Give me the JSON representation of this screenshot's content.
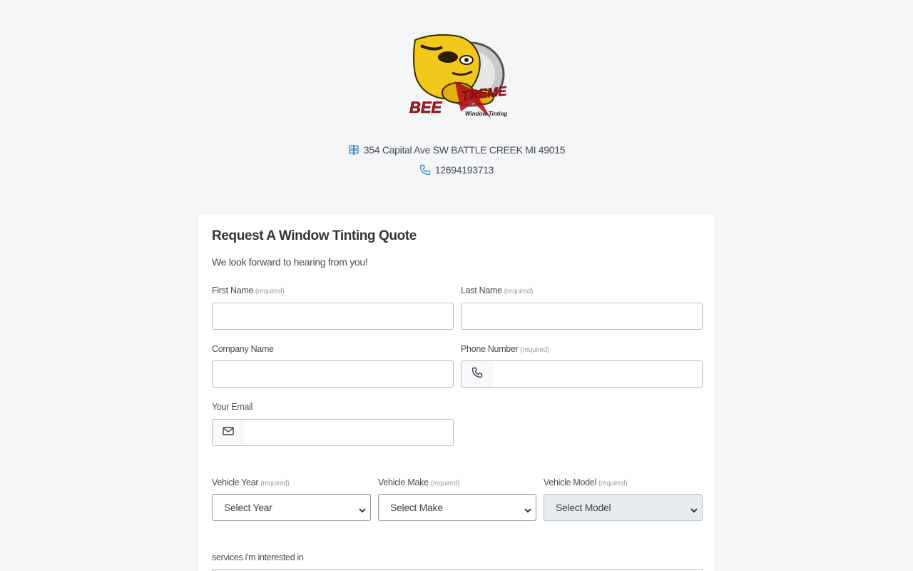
{
  "header": {
    "logo": {
      "brand": "BEE XTREME",
      "tagline": "Window Tinting"
    },
    "address": "354 Capital Ave SW BATTLE CREEK MI 49015",
    "phone": "12694193713"
  },
  "form": {
    "title": "Request A Window Tinting Quote",
    "subtitle": "We look forward to hearing from you!",
    "required_tag": "(required)",
    "first_name": {
      "label": "First Name",
      "value": ""
    },
    "last_name": {
      "label": "Last Name",
      "value": ""
    },
    "company_name": {
      "label": "Company Name",
      "value": ""
    },
    "phone_number": {
      "label": "Phone Number",
      "value": "",
      "icon": "phone-icon"
    },
    "email": {
      "label": "Your Email",
      "value": "",
      "icon": "envelope-icon"
    },
    "vehicle_year": {
      "label": "Vehicle Year",
      "selected": "Select Year"
    },
    "vehicle_make": {
      "label": "Vehicle Make",
      "selected": "Select Make"
    },
    "vehicle_model": {
      "label": "Vehicle Model",
      "selected": "Select Model",
      "disabled": true
    },
    "services": {
      "label": "services i'm interested in"
    }
  },
  "colors": {
    "background": "#f5f6f8",
    "accent_icon": "#3a8fc4",
    "logo_yellow": "#f2c81c",
    "logo_red": "#b5121b"
  }
}
